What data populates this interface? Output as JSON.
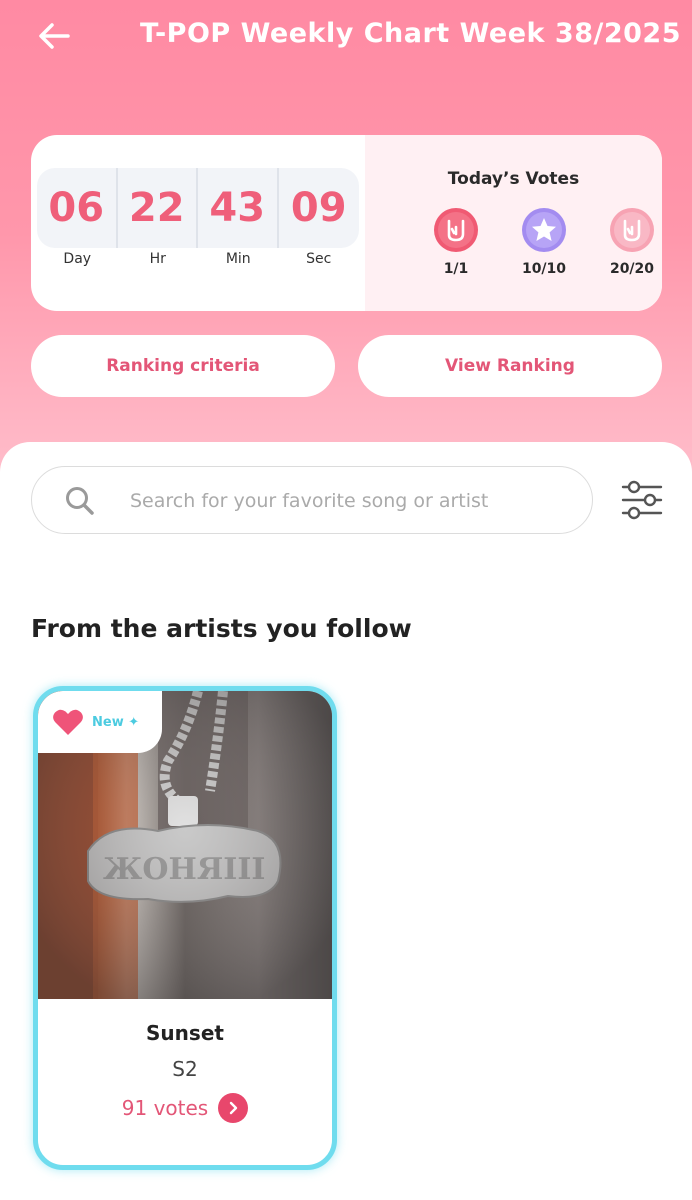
{
  "header": {
    "title": "T-POP Weekly Chart Week 38/2025",
    "back_icon": "arrow-left-icon"
  },
  "countdown": {
    "cells": [
      {
        "value": "06",
        "label": "Day"
      },
      {
        "value": "22",
        "label": "Hr"
      },
      {
        "value": "43",
        "label": "Min"
      },
      {
        "value": "09",
        "label": "Sec"
      }
    ]
  },
  "todays_votes": {
    "title": "Today’s Votes",
    "items": [
      {
        "icon": "rock-hand-coin-icon",
        "count": "1/1",
        "color": "#f05a73"
      },
      {
        "icon": "star-coin-icon",
        "count": "10/10",
        "color": "#a38cf0"
      },
      {
        "icon": "rock-hand-coin-light-icon",
        "count": "20/20",
        "color": "#f7a3b3"
      }
    ]
  },
  "buttons": {
    "ranking_criteria": "Ranking criteria",
    "view_ranking": "View Ranking"
  },
  "search": {
    "placeholder": "Search for your favorite song or artist",
    "value": ""
  },
  "section": {
    "title": "From the artists you follow"
  },
  "song_card": {
    "badge": "New ✦",
    "title": "Sunset",
    "artist": "S2",
    "votes": "91 votes",
    "border_color": "#6fdcee"
  },
  "colors": {
    "accent": "#e35677",
    "countdown_digits": "#ef5f7a"
  }
}
